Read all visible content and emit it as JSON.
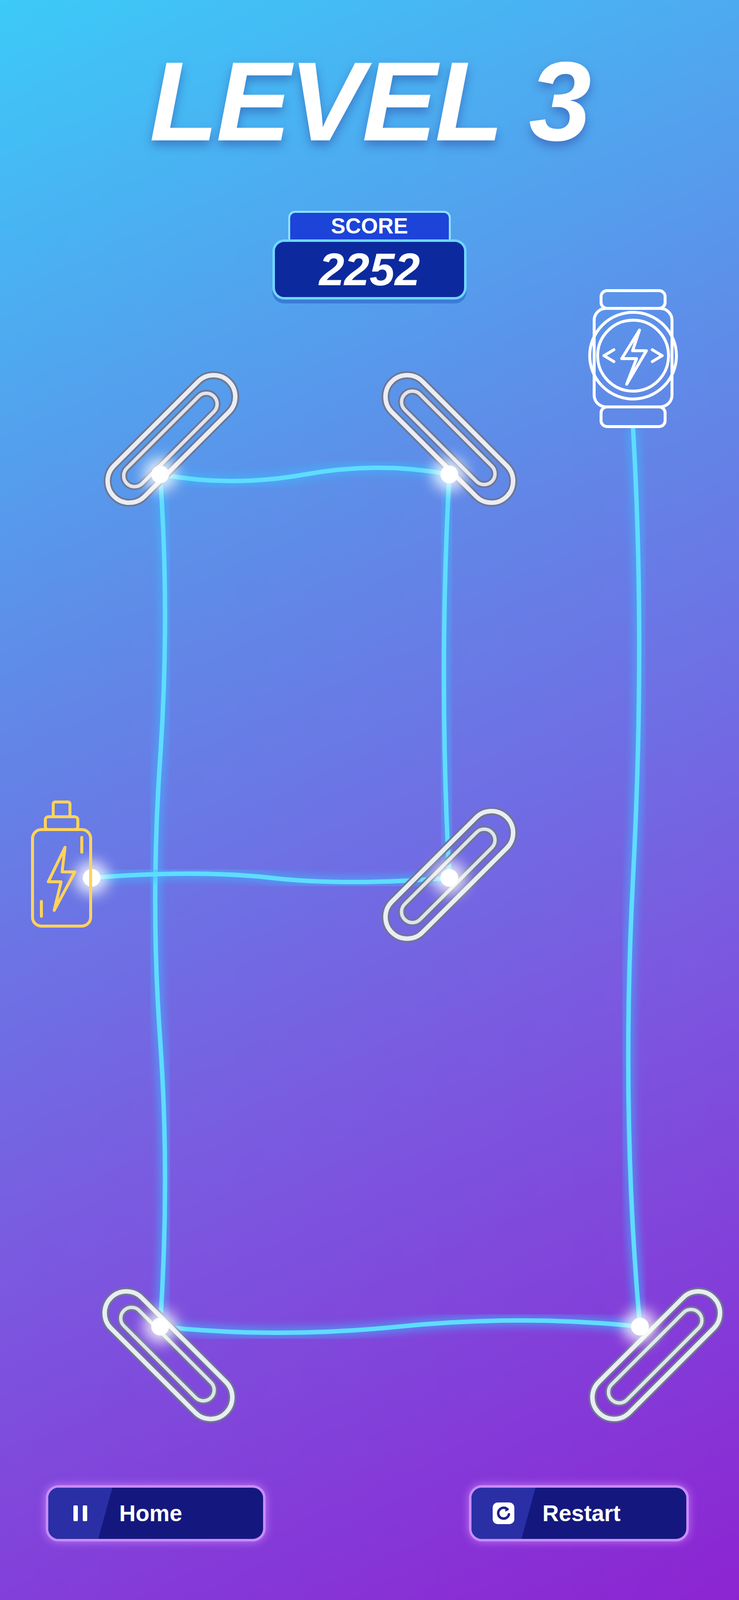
{
  "level": {
    "title": "LEVEL 3"
  },
  "score": {
    "label": "SCORE",
    "value": "2252"
  },
  "circuit": {
    "powered": true
  },
  "buttons": [
    {
      "label": "Home",
      "kind": "pause"
    },
    {
      "label": "Restart",
      "kind": "restart"
    }
  ]
}
